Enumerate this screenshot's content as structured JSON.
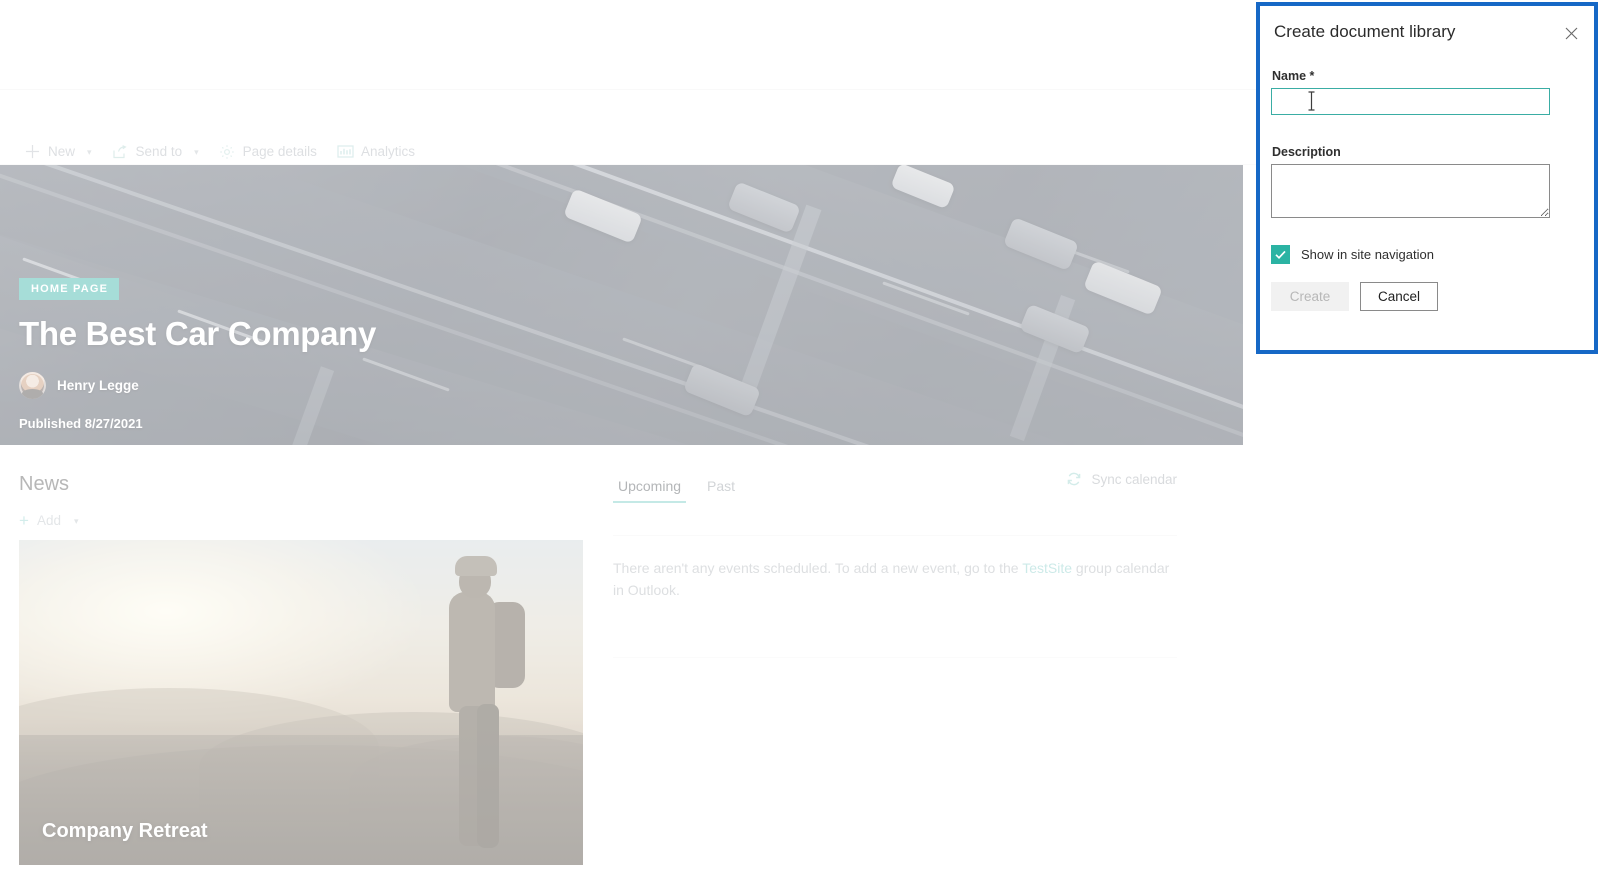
{
  "command_bar": {
    "items": [
      {
        "label": "New",
        "icon": "plus-icon",
        "has_chevron": true
      },
      {
        "label": "Send to",
        "icon": "send-to-icon",
        "has_chevron": true
      },
      {
        "label": "Page details",
        "icon": "gear-icon",
        "has_chevron": false
      },
      {
        "label": "Analytics",
        "icon": "analytics-icon",
        "has_chevron": false
      }
    ]
  },
  "hero": {
    "badge": "HOME PAGE",
    "title": "The Best Car Company",
    "author": "Henry Legge",
    "published": "Published 8/27/2021",
    "badge_color": "#3ab3a9",
    "image_alt": "aerial-highway-photo"
  },
  "news": {
    "heading": "News",
    "add_label": "Add",
    "cards": [
      {
        "title": "Company Retreat",
        "image_alt": "hiker-sunset-photo"
      }
    ]
  },
  "events": {
    "tabs": [
      {
        "label": "Upcoming",
        "active": true
      },
      {
        "label": "Past",
        "active": false
      }
    ],
    "sync_label": "Sync calendar",
    "empty_text_before": "There aren't any events scheduled. To add a new event, go to the ",
    "empty_link": "TestSite",
    "empty_text_after": " group calendar in Outlook.",
    "accent_color": "#7dcfc8"
  },
  "panel": {
    "title": "Create document library",
    "close_icon": "close-icon",
    "highlight_color": "#1668c6",
    "name": {
      "label": "Name",
      "required_marker": "*",
      "value": "",
      "placeholder": ""
    },
    "description": {
      "label": "Description",
      "value": "",
      "placeholder": ""
    },
    "checkbox": {
      "label": "Show in site navigation",
      "checked": true,
      "color": "#2bb3a3"
    },
    "buttons": {
      "create": "Create",
      "create_disabled": true,
      "cancel": "Cancel"
    }
  }
}
